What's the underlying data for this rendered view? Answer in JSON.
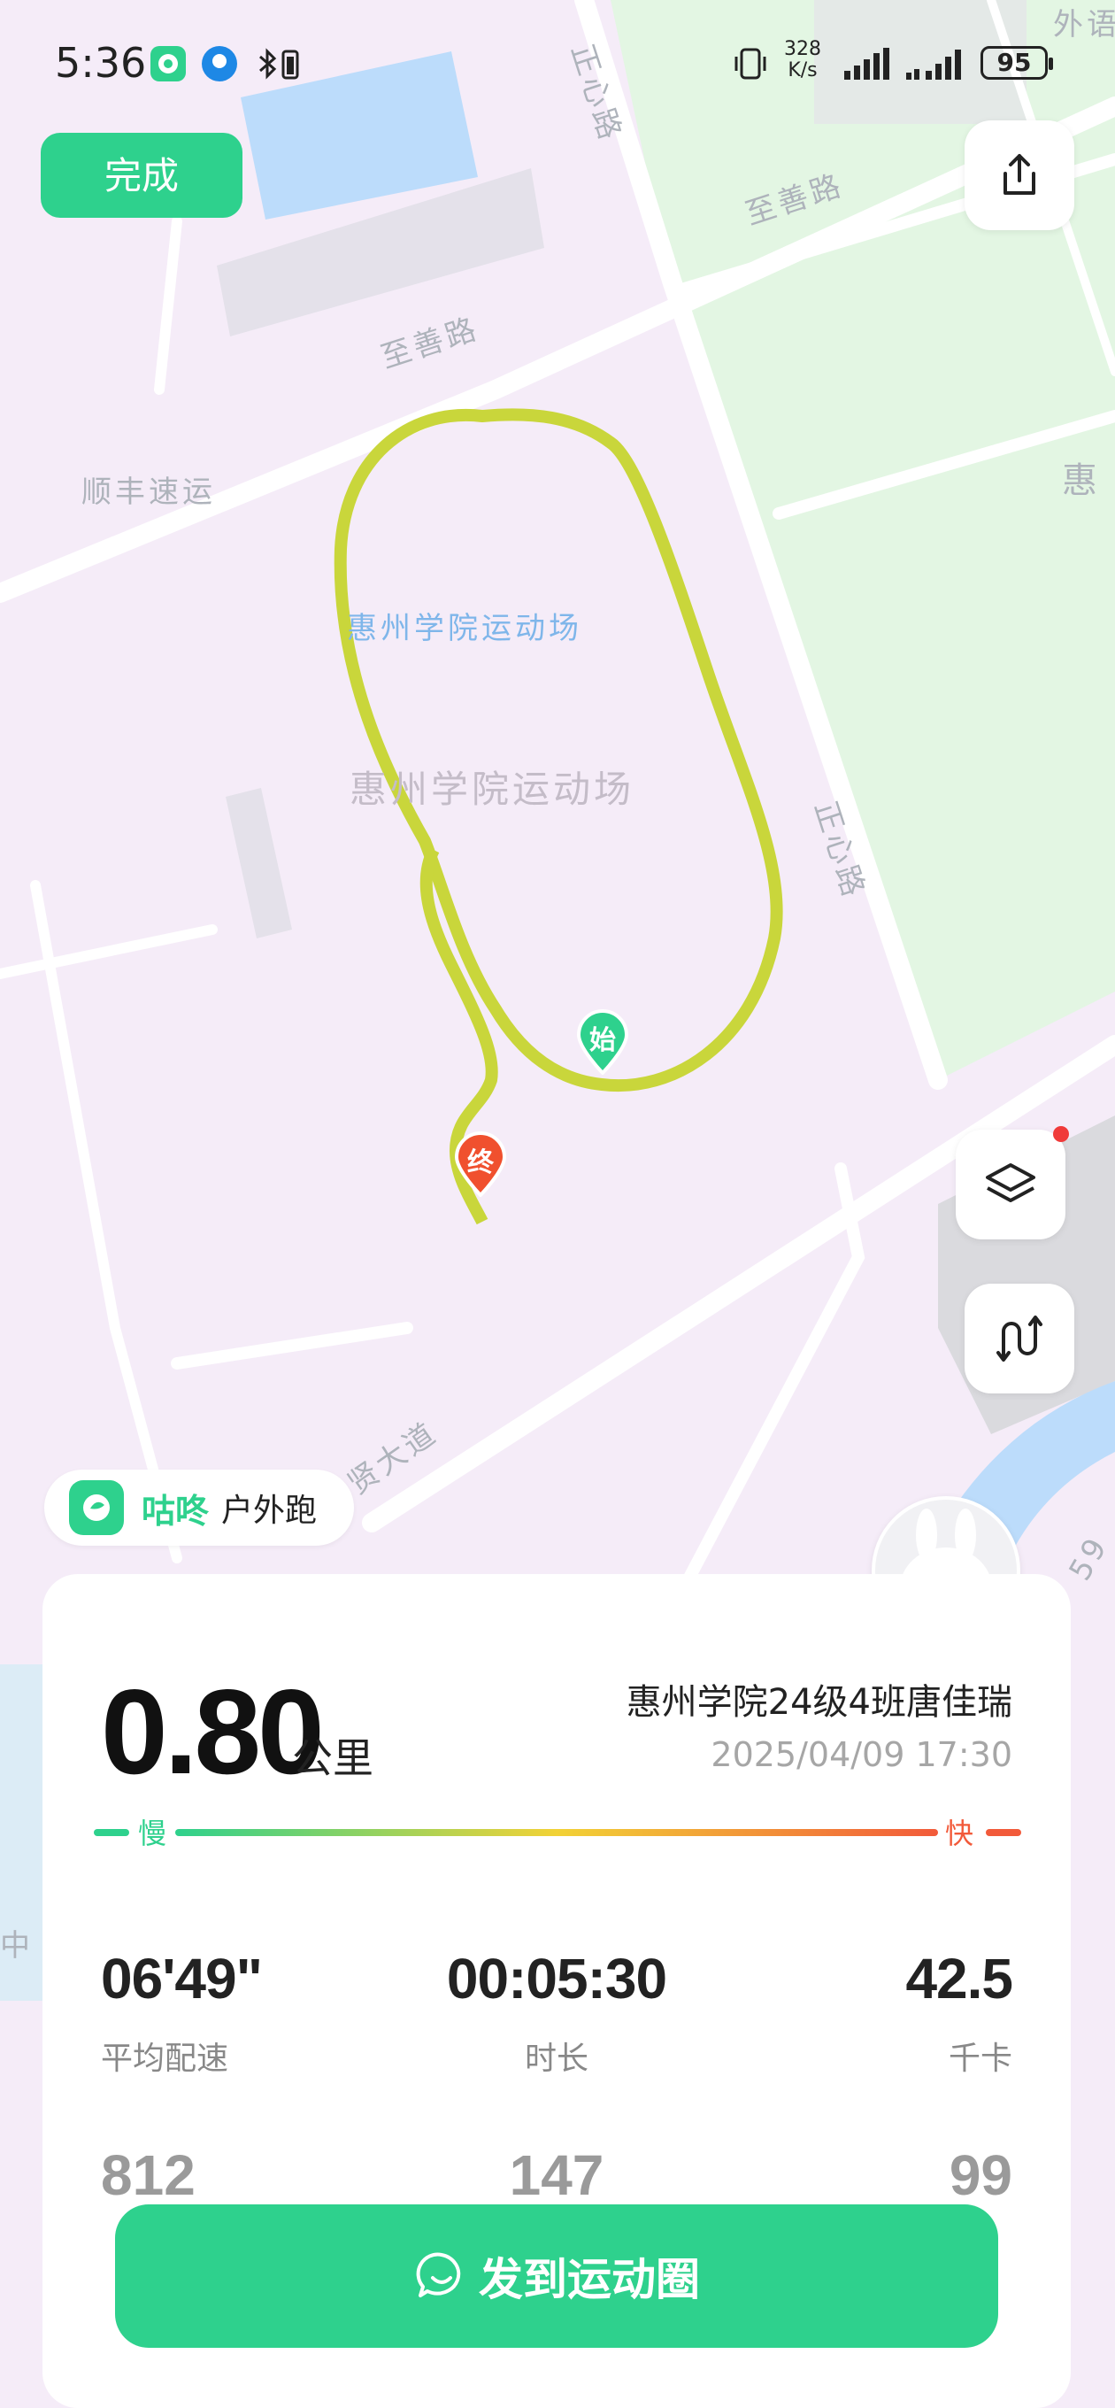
{
  "status_bar": {
    "time": "5:36",
    "net_speed_value": "328",
    "net_speed_unit": "K/s",
    "battery": "95"
  },
  "toolbar": {
    "done_label": "完成"
  },
  "map": {
    "labels": {
      "road_zhishan_top": "至善路",
      "road_zhishan_mid": "至善路",
      "road_zhengxin_top": "正心路",
      "road_zhengxin_mid": "正心路",
      "poi_sf": "顺丰速运",
      "venue_blue": "惠州学院运动场",
      "venue_grey": "惠州学院运动场",
      "road_xian": "贤大道",
      "edge_top_right": "外语",
      "edge_right": "惠",
      "edge_left": "中",
      "edge_right_low": "59"
    },
    "start_marker": "始",
    "end_marker": "终",
    "route_color": "#c9d63b"
  },
  "brand": {
    "name": "咕咚",
    "activity": "户外跑"
  },
  "summary": {
    "distance": "0.80",
    "distance_unit": "公里",
    "owner": "惠州学院24级4班唐佳瑞",
    "datetime": "2025/04/09 17:30",
    "pace_slow": "慢",
    "pace_fast": "快"
  },
  "stats": [
    {
      "value": "06'49\"",
      "label": "平均配速"
    },
    {
      "value": "00:05:30",
      "label": "时长"
    },
    {
      "value": "42.5",
      "label": "千卡"
    }
  ],
  "stats_row2": [
    {
      "value": "812"
    },
    {
      "value": "147"
    },
    {
      "value": "99"
    }
  ],
  "share": {
    "label": "发到运动圈"
  },
  "colors": {
    "accent": "#2ed18d",
    "fast": "#f25a3a",
    "map_campus": "#f5ecf8",
    "map_green": "#e4f7e4",
    "map_water": "#bfe0fb"
  },
  "icons": [
    "wechat-status-icon",
    "app-status-icon",
    "bluetooth-icon",
    "vibrate-icon",
    "signal-icon",
    "share-icon",
    "layers-icon",
    "route-toggle-icon",
    "chat-bubble-icon"
  ]
}
